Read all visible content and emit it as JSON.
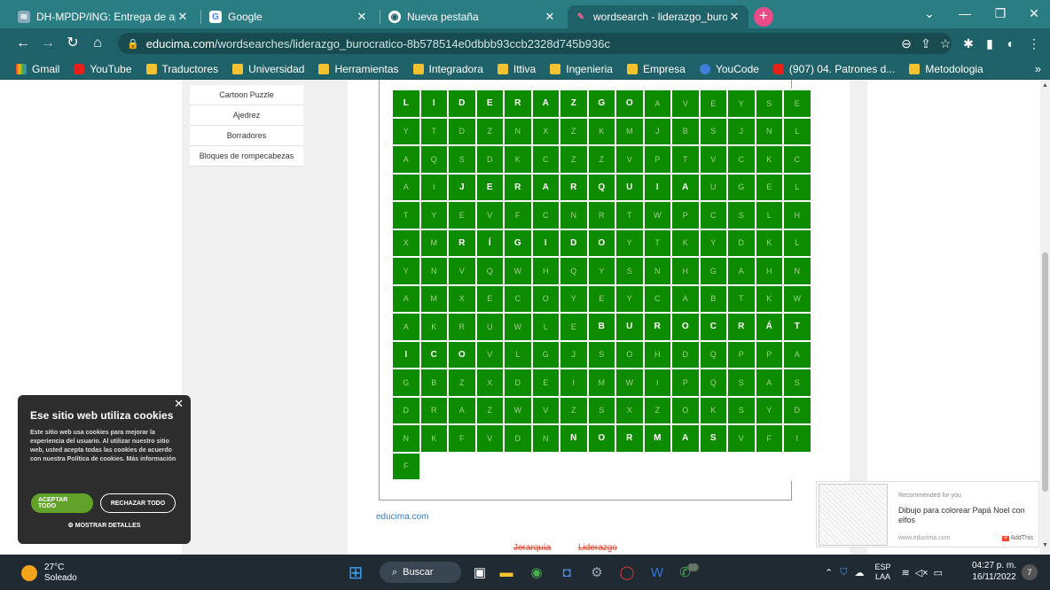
{
  "tabs": [
    {
      "title": "DH-MPDP/ING: Entrega de apun",
      "active": false
    },
    {
      "title": "Google",
      "active": false
    },
    {
      "title": "Nueva pestaña",
      "active": false
    },
    {
      "title": "wordsearch - liderazgo_burocrati",
      "active": true
    }
  ],
  "address": {
    "domain": "educima.com",
    "path": "/wordsearches/liderazgo_burocratico-8b578514e0dbbb93ccb2328d745b936c"
  },
  "bookmarks": [
    {
      "label": "Gmail",
      "icon": "gmail-icon"
    },
    {
      "label": "YouTube",
      "icon": "youtube-icon"
    },
    {
      "label": "Traductores",
      "icon": "folder-icon"
    },
    {
      "label": "Universidad",
      "icon": "folder-icon"
    },
    {
      "label": "Herramientas",
      "icon": "folder-icon"
    },
    {
      "label": "Integradora",
      "icon": "folder-icon"
    },
    {
      "label": "Ittiva",
      "icon": "folder-icon"
    },
    {
      "label": "Ingenieria",
      "icon": "folder-icon"
    },
    {
      "label": "Empresa",
      "icon": "folder-icon"
    },
    {
      "label": "YouCode",
      "icon": "youcode-icon"
    },
    {
      "label": "(907) 04. Patrones d...",
      "icon": "youtube-icon"
    },
    {
      "label": "Metodologia",
      "icon": "folder-icon"
    }
  ],
  "sidebar_menu": [
    "Cartoon Puzzle",
    "Ajedrez",
    "Borradores",
    "Bloques de rompecabezas"
  ],
  "wordsearch": {
    "rows": [
      [
        "L",
        "I",
        "D",
        "E",
        "R",
        "A",
        "Z",
        "G",
        "O",
        "A",
        "V",
        "E",
        "Y",
        "S"
      ],
      [
        "E",
        "Y",
        "T",
        "D",
        "Z",
        "N",
        "X",
        "Z",
        "K",
        "M",
        "J",
        "B",
        "S",
        "J"
      ],
      [
        "N",
        "L",
        "A",
        "Q",
        "S",
        "D",
        "K",
        "C",
        "Z",
        "Z",
        "V",
        "P",
        "T",
        "V"
      ],
      [
        "C",
        "K",
        "C",
        "A",
        "I",
        "J",
        "E",
        "R",
        "A",
        "R",
        "Q",
        "U",
        "I",
        "A"
      ],
      [
        "U",
        "G",
        "E",
        "L",
        "T",
        "Y",
        "E",
        "V",
        "F",
        "C",
        "N",
        "R",
        "T",
        "W"
      ],
      [
        "P",
        "C",
        "S",
        "L",
        "H",
        "X",
        "M",
        "R",
        "Í",
        "G",
        "I",
        "D",
        "O",
        "Y"
      ],
      [
        "T",
        "K",
        "Y",
        "D",
        "K",
        "L",
        "Y",
        "N",
        "V",
        "Q",
        "W",
        "H",
        "Q",
        "Y"
      ],
      [
        "S",
        "N",
        "H",
        "G",
        "A",
        "H",
        "N",
        "A",
        "M",
        "X",
        "E",
        "C",
        "O",
        "Y"
      ],
      [
        "E",
        "Y",
        "C",
        "A",
        "B",
        "T",
        "K",
        "W",
        "A",
        "K",
        "R",
        "U",
        "W",
        "L"
      ],
      [
        "E",
        "B",
        "U",
        "R",
        "O",
        "C",
        "R",
        "Á",
        "T",
        "I",
        "C",
        "O",
        "V",
        "L"
      ],
      [
        "G",
        "J",
        "S",
        "O",
        "H",
        "D",
        "Q",
        "P",
        "P",
        "A",
        "G",
        "B",
        "Z",
        "X"
      ],
      [
        "D",
        "E",
        "I",
        "M",
        "W",
        "I",
        "P",
        "Q",
        "S",
        "A",
        "S",
        "D",
        "R",
        "A"
      ],
      [
        "Z",
        "W",
        "V",
        "Z",
        "S",
        "X",
        "Z",
        "O",
        "K",
        "S",
        "Y",
        "D",
        "N",
        "K"
      ],
      [
        "F",
        "V",
        "D",
        "N",
        "N",
        "O",
        "R",
        "M",
        "A",
        "S",
        "V",
        "F",
        "I",
        "F"
      ]
    ],
    "highlighted": [
      [
        0,
        0
      ],
      [
        0,
        1
      ],
      [
        0,
        2
      ],
      [
        0,
        3
      ],
      [
        0,
        4
      ],
      [
        0,
        5
      ],
      [
        0,
        6
      ],
      [
        0,
        7
      ],
      [
        0,
        8
      ],
      [
        3,
        5
      ],
      [
        3,
        6
      ],
      [
        3,
        7
      ],
      [
        3,
        8
      ],
      [
        3,
        9
      ],
      [
        3,
        10
      ],
      [
        3,
        11
      ],
      [
        3,
        12
      ],
      [
        3,
        13
      ],
      [
        5,
        7
      ],
      [
        5,
        8
      ],
      [
        5,
        9
      ],
      [
        5,
        10
      ],
      [
        5,
        11
      ],
      [
        5,
        12
      ],
      [
        9,
        1
      ],
      [
        9,
        2
      ],
      [
        9,
        3
      ],
      [
        9,
        4
      ],
      [
        9,
        5
      ],
      [
        9,
        6
      ],
      [
        9,
        7
      ],
      [
        9,
        8
      ],
      [
        9,
        9
      ],
      [
        9,
        10
      ],
      [
        9,
        11
      ],
      [
        13,
        4
      ],
      [
        13,
        5
      ],
      [
        13,
        6
      ],
      [
        13,
        7
      ],
      [
        13,
        8
      ],
      [
        13,
        9
      ]
    ]
  },
  "footer_link": "educima.com",
  "found_words": [
    "Jerarquía",
    "Liderazgo"
  ],
  "cookie": {
    "title": "Ese sitio web utiliza cookies",
    "body": "Este sitio web usa cookies para mejorar la experiencia del usuario. Al utilizar nuestro sitio web, usted acepta todas las cookies de acuerdo con nuestra Política de cookies. Más información",
    "accept": "ACEPTAR TODO",
    "reject": "RECHAZAR TODO",
    "details": "MOSTRAR DETALLES"
  },
  "ad": {
    "recommended": "Recommended for you",
    "title": "Dibujo para colorear Papá Noel con elfos",
    "source": "www.educima.com",
    "brand": "AddThis"
  },
  "taskbar": {
    "temperature": "27°C",
    "weather": "Soleado",
    "search": "Buscar",
    "lang1": "ESP",
    "lang2": "LAA",
    "time": "04:27 p. m.",
    "date": "16/11/2022",
    "badge": "10",
    "notif": "7"
  },
  "colors": {
    "chrome": "#1f6168",
    "cell": "#0e8c00",
    "accept": "#61a229"
  }
}
